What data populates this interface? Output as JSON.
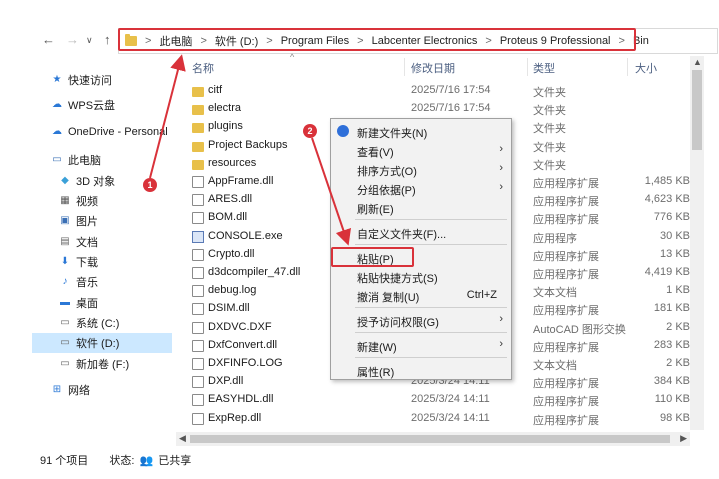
{
  "address": {
    "crumbs": [
      "此电脑",
      "软件 (D:)",
      "Program Files",
      "Labcenter Electronics",
      "Proteus 9 Professional",
      "Bin"
    ],
    "separator": ">"
  },
  "nav": {
    "back": "←",
    "forward": "→",
    "recent": "∨",
    "up": "↑"
  },
  "columns": {
    "name": "名称",
    "date": "修改日期",
    "type": "类型",
    "size": "大小"
  },
  "sidebar": {
    "items": [
      {
        "label": "快速访问",
        "icon": "star-icon"
      },
      {
        "label": "WPS云盘",
        "icon": "cloud-icon"
      },
      {
        "label": "OneDrive - Personal",
        "icon": "cloud-icon"
      },
      {
        "label": "此电脑",
        "icon": "computer-icon"
      },
      {
        "label": "3D 对象",
        "icon": "cube-icon"
      },
      {
        "label": "视频",
        "icon": "video-icon"
      },
      {
        "label": "图片",
        "icon": "picture-icon"
      },
      {
        "label": "文档",
        "icon": "document-icon"
      },
      {
        "label": "下载",
        "icon": "download-icon"
      },
      {
        "label": "音乐",
        "icon": "music-icon"
      },
      {
        "label": "桌面",
        "icon": "desktop-icon"
      },
      {
        "label": "系统 (C:)",
        "icon": "drive-icon"
      },
      {
        "label": "软件 (D:)",
        "icon": "drive-icon"
      },
      {
        "label": "新加卷 (F:)",
        "icon": "drive-icon"
      },
      {
        "label": "网络",
        "icon": "network-icon"
      }
    ]
  },
  "files": [
    {
      "name": "citf",
      "date": "2025/7/16 17:54",
      "type": "文件夹",
      "size": "",
      "kind": "folder"
    },
    {
      "name": "electra",
      "date": "2025/7/16 17:54",
      "type": "文件夹",
      "size": "",
      "kind": "folder"
    },
    {
      "name": "plugins",
      "date": "",
      "type": "文件夹",
      "size": "",
      "kind": "folder"
    },
    {
      "name": "Project Backups",
      "date": "",
      "type": "文件夹",
      "size": "",
      "kind": "folder"
    },
    {
      "name": "resources",
      "date": "",
      "type": "文件夹",
      "size": "",
      "kind": "folder"
    },
    {
      "name": "AppFrame.dll",
      "date": "",
      "type": "应用程序扩展",
      "size": "1,485 KB",
      "kind": "file"
    },
    {
      "name": "ARES.dll",
      "date": "",
      "type": "应用程序扩展",
      "size": "4,623 KB",
      "kind": "file"
    },
    {
      "name": "BOM.dll",
      "date": "",
      "type": "应用程序扩展",
      "size": "776 KB",
      "kind": "file"
    },
    {
      "name": "CONSOLE.exe",
      "date": "",
      "type": "应用程序",
      "size": "30 KB",
      "kind": "exe"
    },
    {
      "name": "Crypto.dll",
      "date": "",
      "type": "应用程序扩展",
      "size": "13 KB",
      "kind": "file"
    },
    {
      "name": "d3dcompiler_47.dll",
      "date": "",
      "type": "应用程序扩展",
      "size": "4,419 KB",
      "kind": "file"
    },
    {
      "name": "debug.log",
      "date": "",
      "type": "文本文档",
      "size": "1 KB",
      "kind": "file"
    },
    {
      "name": "DSIM.dll",
      "date": "",
      "type": "应用程序扩展",
      "size": "181 KB",
      "kind": "file"
    },
    {
      "name": "DXDVC.DXF",
      "date": "",
      "type": "AutoCAD 图形交换",
      "size": "2 KB",
      "kind": "file"
    },
    {
      "name": "DxfConvert.dll",
      "date": "",
      "type": "应用程序扩展",
      "size": "283 KB",
      "kind": "file"
    },
    {
      "name": "DXFINFO.LOG",
      "date": "",
      "type": "文本文档",
      "size": "2 KB",
      "kind": "file"
    },
    {
      "name": "DXP.dll",
      "date": "2025/3/24 14:11",
      "type": "应用程序扩展",
      "size": "384 KB",
      "kind": "file"
    },
    {
      "name": "EASYHDL.dll",
      "date": "2025/3/24 14:11",
      "type": "应用程序扩展",
      "size": "110 KB",
      "kind": "file"
    },
    {
      "name": "ExpRep.dll",
      "date": "2025/3/24 14:11",
      "type": "应用程序扩展",
      "size": "98 KB",
      "kind": "file"
    }
  ],
  "context_menu": {
    "items": [
      {
        "label": "新建文件夹(N)",
        "arrow": "",
        "shortcut": ""
      },
      {
        "label": "查看(V)",
        "arrow": "›",
        "shortcut": ""
      },
      {
        "label": "排序方式(O)",
        "arrow": "›",
        "shortcut": ""
      },
      {
        "label": "分组依据(P)",
        "arrow": "›",
        "shortcut": ""
      },
      {
        "label": "刷新(E)",
        "arrow": "",
        "shortcut": ""
      },
      {
        "label": "自定义文件夹(F)...",
        "arrow": "",
        "shortcut": ""
      },
      {
        "label": "粘贴(P)",
        "arrow": "",
        "shortcut": ""
      },
      {
        "label": "粘贴快捷方式(S)",
        "arrow": "",
        "shortcut": ""
      },
      {
        "label": "撤消 复制(U)",
        "arrow": "",
        "shortcut": "Ctrl+Z"
      },
      {
        "label": "授予访问权限(G)",
        "arrow": "›",
        "shortcut": ""
      },
      {
        "label": "新建(W)",
        "arrow": "›",
        "shortcut": ""
      },
      {
        "label": "属性(R)",
        "arrow": "",
        "shortcut": ""
      }
    ]
  },
  "status": {
    "count": "91 个项目",
    "state": "状态:",
    "shared": "已共享"
  },
  "markers": {
    "one": "1",
    "two": "2"
  },
  "colors": {
    "highlight": "#d9323a",
    "selection": "#cce8ff",
    "folder": "#e8c04a"
  }
}
